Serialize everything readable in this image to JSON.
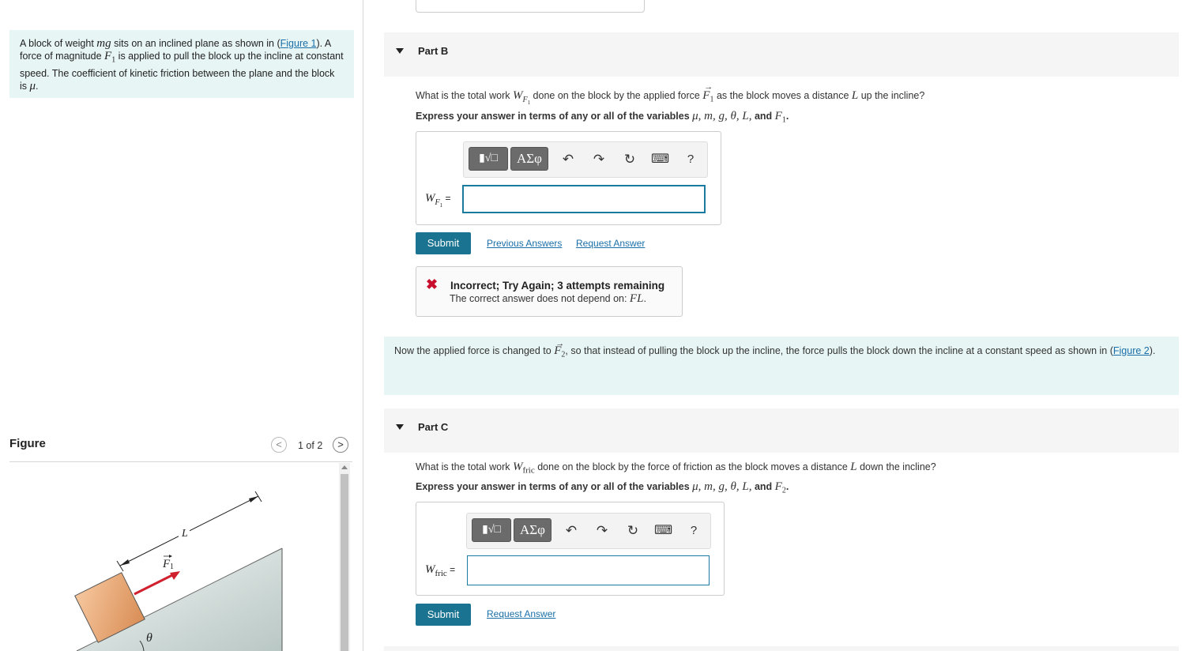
{
  "intro": {
    "p1": "A block of weight ",
    "mg": "mg",
    "p2": " sits on an inclined plane as shown in (",
    "figure_link": "Figure 1",
    "p3": "). A force of magnitude ",
    "F1": "F",
    "F1_sub": "1",
    "p4": " is applied to pull the block up the incline at constant speed. The coefficient of kinetic friction between the plane and the block is ",
    "mu": "μ",
    "p5": "."
  },
  "figure": {
    "title": "Figure",
    "prev": "<",
    "next": ">",
    "pager": "1 of 2",
    "label_L": "L",
    "label_F": "F",
    "label_F_sub": "1",
    "label_theta": "θ"
  },
  "partB": {
    "title": "Part B",
    "q1": "What is the total work ",
    "W": "W",
    "W_sub": "F",
    "W_subsub": "1",
    "q2": " done on the block by the applied force ",
    "F": "F",
    "F_sub": "1",
    "q3": " as the block moves a distance ",
    "L": "L",
    "q4": " up the incline?",
    "express_prefix": "Express your answer in terms of any or all of the variables ",
    "variables": "μ, m, g, θ, L,",
    "and": " and ",
    "last_var": "F",
    "last_var_sub": "1",
    "dot": ".",
    "answer_label": "W",
    "answer_label_sub": "F",
    "answer_label_subsub": "1",
    "equals": " =",
    "input_value": "",
    "submit": "Submit",
    "prev_answers": "Previous Answers",
    "request_answer": "Request Answer"
  },
  "toolbar": {
    "templates": "▮√□",
    "greek": "ΑΣφ",
    "undo": "↶",
    "redo": "↷",
    "reset": "↻",
    "keyboard": "⌨",
    "help": "?"
  },
  "feedback": {
    "icon": "✖",
    "title": "Incorrect; Try Again; 3 attempts remaining",
    "detail_prefix": "The correct answer does not depend on: ",
    "detail_var": "FL",
    "detail_suffix": "."
  },
  "info2": {
    "p1": "Now the applied force is changed to ",
    "F": "F",
    "F_sub": "2",
    "p2": ", so that instead of pulling the block up the incline, the force pulls the block down the incline at a constant speed as shown in (",
    "link": "Figure 2",
    "p3": ")."
  },
  "partC": {
    "title": "Part C",
    "q1": "What is the total work ",
    "W": "W",
    "W_sub": "fric",
    "q2": " done on the block by the force of friction as the block moves a distance ",
    "L": "L",
    "q3": " down the incline?",
    "express_prefix": "Express your answer in terms of any or all of the variables ",
    "variables": "μ, m, g, θ, L,",
    "and": " and ",
    "last_var": "F",
    "last_var_sub": "2",
    "dot": ".",
    "answer_label": "W",
    "answer_label_sub": "fric",
    "equals": " =",
    "input_value": "",
    "submit": "Submit",
    "request_answer": "Request Answer"
  }
}
